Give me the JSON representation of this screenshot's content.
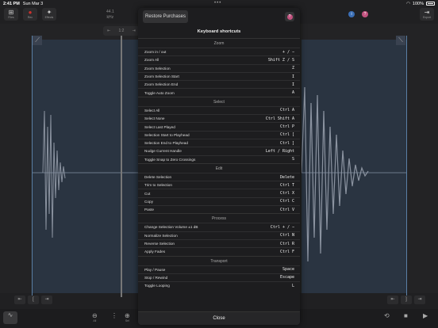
{
  "status": {
    "time": "2:41 PM",
    "date": "Sun Mar 3",
    "battery": "100%"
  },
  "toolbar": {
    "left": [
      {
        "glyph": "⊞",
        "label": "Files"
      },
      {
        "glyph": "●",
        "label": "Rec"
      },
      {
        "glyph": "✦",
        "label": "Effects"
      }
    ],
    "right_label": "Export",
    "sample_rate": "44.1",
    "sample_rate_unit": "kHz",
    "zoom_value": "1:2"
  },
  "modal": {
    "restore_label": "Restore Purchases",
    "title": "Keyboard shortcuts",
    "close_label": "Close",
    "sections": [
      {
        "name": "Zoom",
        "rows": [
          {
            "action": "Zoom in / out",
            "key": "+ / −"
          },
          {
            "action": "Zoom All",
            "key": "Shift Z / S"
          },
          {
            "action": "Zoom Selection",
            "key": "Z"
          },
          {
            "action": "Zoom Selection Start",
            "key": "I"
          },
          {
            "action": "Zoom Selection End",
            "key": "I"
          },
          {
            "action": "Toggle Auto Zoom",
            "key": "A"
          }
        ]
      },
      {
        "name": "Select",
        "rows": [
          {
            "action": "Select All",
            "key": "Ctrl A"
          },
          {
            "action": "Select None",
            "key": "Ctrl Shift A"
          },
          {
            "action": "Select Last Played",
            "key": "Ctrl P"
          },
          {
            "action": "Selection Start to Playhead",
            "key": "Ctrl ["
          },
          {
            "action": "Selection End to Playhead",
            "key": "Ctrl ]"
          },
          {
            "action": "Nudge Current Handle",
            "key": "Left / Right"
          },
          {
            "action": "Toggle Snap to Zero Crossings",
            "key": "S"
          }
        ]
      },
      {
        "name": "Edit",
        "rows": [
          {
            "action": "Delete Selection",
            "key": "Delete"
          },
          {
            "action": "Trim to Selection",
            "key": "Ctrl T"
          },
          {
            "action": "Cut",
            "key": "Ctrl X"
          },
          {
            "action": "Copy",
            "key": "Ctrl C"
          },
          {
            "action": "Paste",
            "key": "Ctrl V"
          }
        ]
      },
      {
        "name": "Process",
        "rows": [
          {
            "action": "Change Selection Volume ±1 dB",
            "key": "Ctrl + / −"
          },
          {
            "action": "Normalize Selection",
            "key": "Ctrl N"
          },
          {
            "action": "Reverse Selection",
            "key": "Ctrl R"
          },
          {
            "action": "Apply Fades",
            "key": "Ctrl F"
          }
        ]
      },
      {
        "name": "Transport",
        "rows": [
          {
            "action": "Play / Pause",
            "key": "Space"
          },
          {
            "action": "Stop / Rewind",
            "key": "Escape"
          },
          {
            "action": "Toggle Looping",
            "key": "L"
          }
        ]
      }
    ]
  },
  "bottom": {
    "zoom_out_label": "All",
    "zoom_in_label": "Sel"
  }
}
